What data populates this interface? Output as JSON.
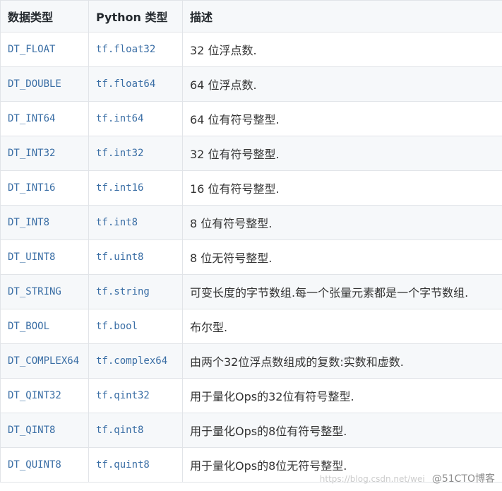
{
  "table": {
    "headers": [
      "数据类型",
      "Python 类型",
      "描述"
    ],
    "rows": [
      [
        "DT_FLOAT",
        "tf.float32",
        "32 位浮点数."
      ],
      [
        "DT_DOUBLE",
        "tf.float64",
        "64 位浮点数."
      ],
      [
        "DT_INT64",
        "tf.int64",
        "64 位有符号整型."
      ],
      [
        "DT_INT32",
        "tf.int32",
        "32 位有符号整型."
      ],
      [
        "DT_INT16",
        "tf.int16",
        "16 位有符号整型."
      ],
      [
        "DT_INT8",
        "tf.int8",
        "8 位有符号整型."
      ],
      [
        "DT_UINT8",
        "tf.uint8",
        "8 位无符号整型."
      ],
      [
        "DT_STRING",
        "tf.string",
        "可变长度的字节数组.每一个张量元素都是一个字节数组."
      ],
      [
        "DT_BOOL",
        "tf.bool",
        "布尔型."
      ],
      [
        "DT_COMPLEX64",
        "tf.complex64",
        "由两个32位浮点数组成的复数:实数和虚数."
      ],
      [
        "DT_QINT32",
        "tf.qint32",
        "用于量化Ops的32位有符号整型."
      ],
      [
        "DT_QINT8",
        "tf.qint8",
        "用于量化Ops的8位有符号整型."
      ],
      [
        "DT_QUINT8",
        "tf.quint8",
        "用于量化Ops的8位无符号整型."
      ]
    ]
  },
  "watermark": {
    "site_text": "https://blog.csdn.net/wei",
    "brand_text": "@51CTO博客"
  }
}
